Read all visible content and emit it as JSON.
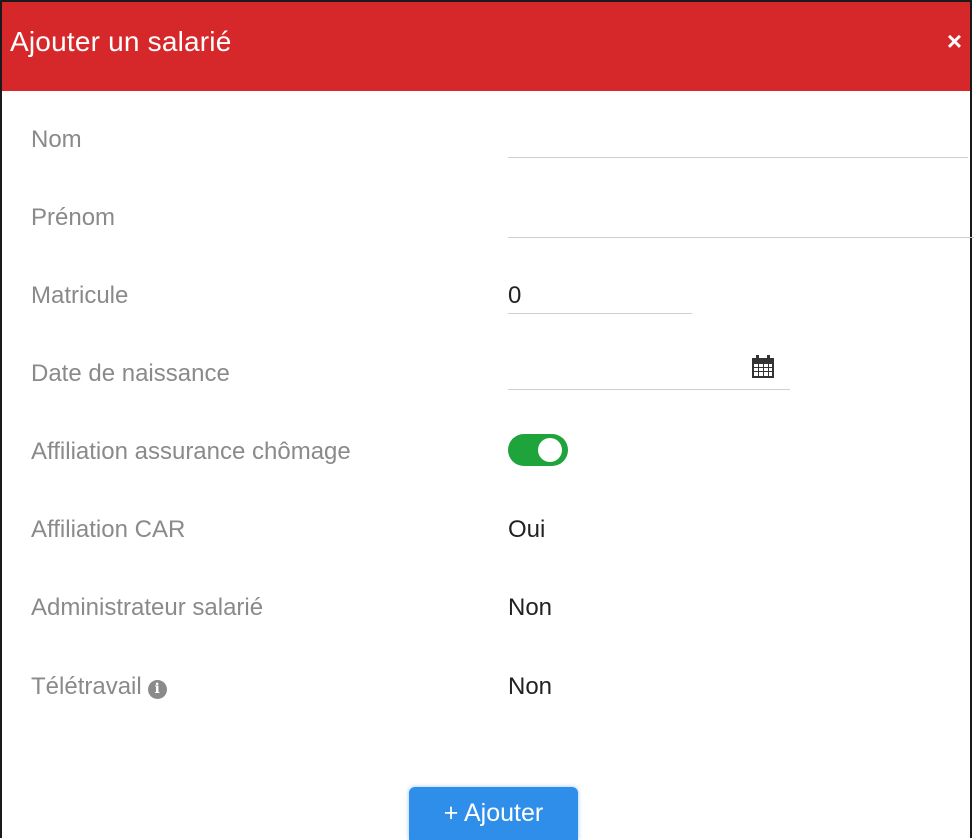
{
  "modal": {
    "title": "Ajouter un salarié",
    "close": "×",
    "accent": "#d6282b"
  },
  "form": {
    "nom": {
      "label": "Nom",
      "value": ""
    },
    "prenom": {
      "label": "Prénom",
      "value": ""
    },
    "matricule": {
      "label": "Matricule",
      "value": "0"
    },
    "date_naissance": {
      "label": "Date de naissance",
      "value": "",
      "icon": "calendar-icon"
    },
    "affiliation_chomage": {
      "label": "Affiliation assurance chômage",
      "checked": true,
      "color": "#1fa33b"
    },
    "affiliation_car": {
      "label": "Affiliation CAR",
      "value": "Oui"
    },
    "administrateur": {
      "label": "Administrateur salarié",
      "value": "Non"
    },
    "teletravail": {
      "label": "Télétravail",
      "value": "Non",
      "info_icon": "info-icon",
      "info_glyph": "i"
    }
  },
  "actions": {
    "add_label": "+ Ajouter",
    "add_color": "#2e8ee9"
  }
}
